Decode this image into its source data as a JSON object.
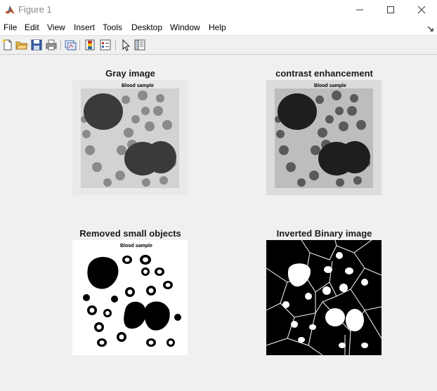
{
  "window": {
    "title": "Figure 1"
  },
  "menu": [
    "File",
    "Edit",
    "View",
    "Insert",
    "Tools",
    "Desktop",
    "Window",
    "Help"
  ],
  "toolbar": {
    "icons": [
      "new-figure-icon",
      "open-file-icon",
      "save-icon",
      "print-icon",
      "link-plot-icon",
      "insert-colorbar-icon",
      "insert-legend-icon",
      "edit-plot-icon",
      "property-inspector-icon"
    ]
  },
  "subplots": [
    {
      "title": "Gray image",
      "inner_label": "Blood sample"
    },
    {
      "title": "contrast enhancement",
      "inner_label": "Blood sample"
    },
    {
      "title": "Removed small objects",
      "inner_label": "Blood sample"
    },
    {
      "title": "Inverted Binary image"
    }
  ]
}
